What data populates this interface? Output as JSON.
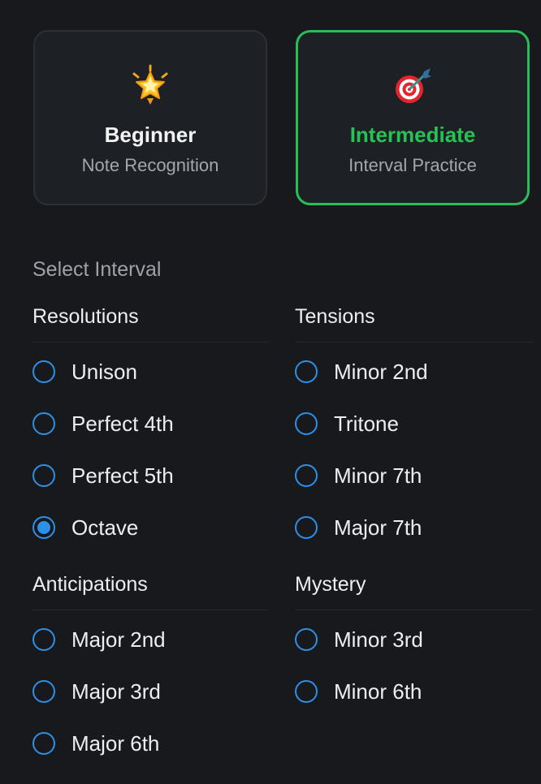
{
  "levels": [
    {
      "icon": "glowing-star-icon",
      "title": "Beginner",
      "subtitle": "Note Recognition",
      "selected": false
    },
    {
      "icon": "direct-hit-target-icon",
      "title": "Intermediate",
      "subtitle": "Interval Practice",
      "selected": true
    }
  ],
  "accent_color": "#27c254",
  "radio_color": "#2e8fe6",
  "section_label": "Select Interval",
  "groups": {
    "resolutions": {
      "title": "Resolutions",
      "options": [
        "Unison",
        "Perfect 4th",
        "Perfect 5th",
        "Octave"
      ]
    },
    "tensions": {
      "title": "Tensions",
      "options": [
        "Minor 2nd",
        "Tritone",
        "Minor 7th",
        "Major 7th"
      ]
    },
    "anticipations": {
      "title": "Anticipations",
      "options": [
        "Major 2nd",
        "Major 3rd",
        "Major 6th"
      ]
    },
    "mystery": {
      "title": "Mystery",
      "options": [
        "Minor 3rd",
        "Minor 6th"
      ]
    }
  },
  "selected_interval": "Octave"
}
